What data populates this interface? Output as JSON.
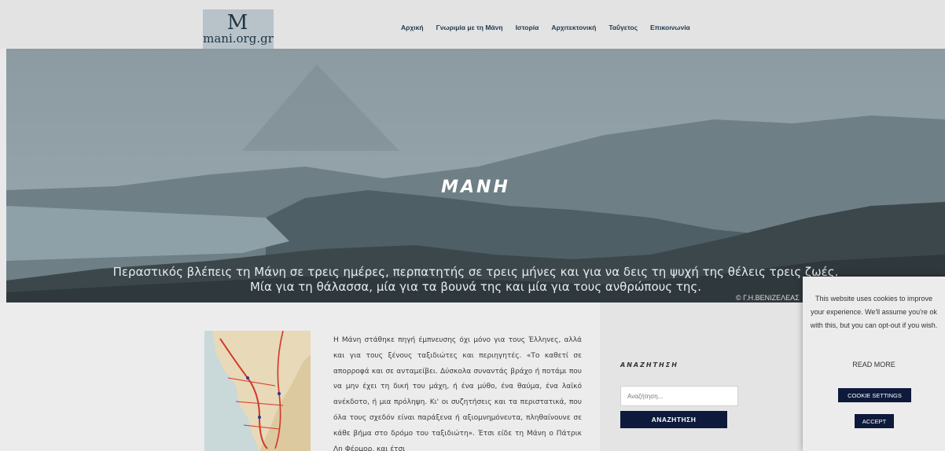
{
  "header": {
    "logo_mark": "M",
    "logo_text": "mani.org.gr",
    "nav": [
      "Αρχική",
      "Γνωριμία με τη Μάνη",
      "Ιστορία",
      "Αρχιτεκτονική",
      "Ταΰγετος",
      "Επικοινωνία"
    ]
  },
  "hero": {
    "title": "ΜΑΝΗ",
    "quote_line1": "Περαστικός βλέπεις τη Μάνη σε τρεις ημέρες, περπατητής σε τρεις μήνες και για να δεις τη ψυχή της θέλεις τρεις ζωές.",
    "quote_line2": "Μία για τη θάλασσα, μία για τα βουνά της και μία για τους ανθρώπους της.",
    "credit": "© Γ.Η.ΒΕΝΙΖΕΛΕΑΣ"
  },
  "article": {
    "text": "Η Μάνη στάθηκε πηγή έμπνευσης όχι μόνο για τους Έλληνες, αλλά και για τους ξένους ταξιδιώτες και περιηγητές. «Το καθετί σε απορροφά και σε ανταμείβει. Δύσκολα συναντάς βράχο ή ποτάμι που να μην έχει τη δική του μάχη, ή ένα μύθο, ένα θαύμα, ένα λαϊκό ανέκδοτο, ή μια πρόληψη. Κι' οι συζητήσεις και τα περιστατικά, που όλα τους σχεδόν είναι παράξενα ή αξιομνημόνευτα, πληθαίνουνε σε κάθε βήμα στο δρόμο του ταξιδιώτη». Έτσι είδε τη Μάνη ο Πάτρικ Λη Φέρμορ, και έτσι"
  },
  "search": {
    "title": "ΑΝΑΖΗΤΗΣΗ",
    "placeholder": "Αναζήτηση...",
    "button": "ΑΝΑΖΗΤΗΣΗ"
  },
  "cookie": {
    "message": "This website uses cookies to improve your experience. We'll assume you're ok with this, but you can opt-out if you wish.",
    "read_more": "READ MORE",
    "settings": "COOKIE SETTINGS",
    "accept": "ACCEPT"
  },
  "colors": {
    "navy": "#0e1a3b",
    "nav_text": "#243a52"
  }
}
